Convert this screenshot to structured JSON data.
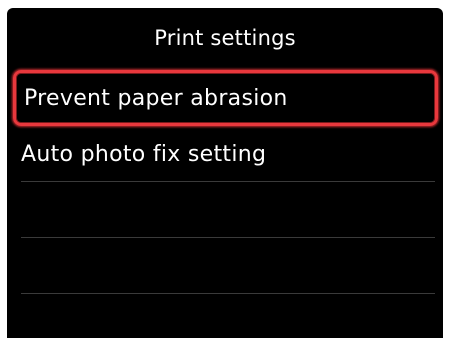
{
  "header": {
    "title": "Print settings"
  },
  "menu": {
    "items": [
      {
        "label": "Prevent paper abrasion",
        "selected": true
      },
      {
        "label": "Auto photo fix setting",
        "selected": false
      },
      {
        "label": "",
        "selected": false
      },
      {
        "label": "",
        "selected": false
      },
      {
        "label": "",
        "selected": false
      }
    ]
  },
  "colors": {
    "background": "#000000",
    "text": "#ffffff",
    "selection_border": "#e8383d",
    "divider": "#3a3a3a"
  }
}
